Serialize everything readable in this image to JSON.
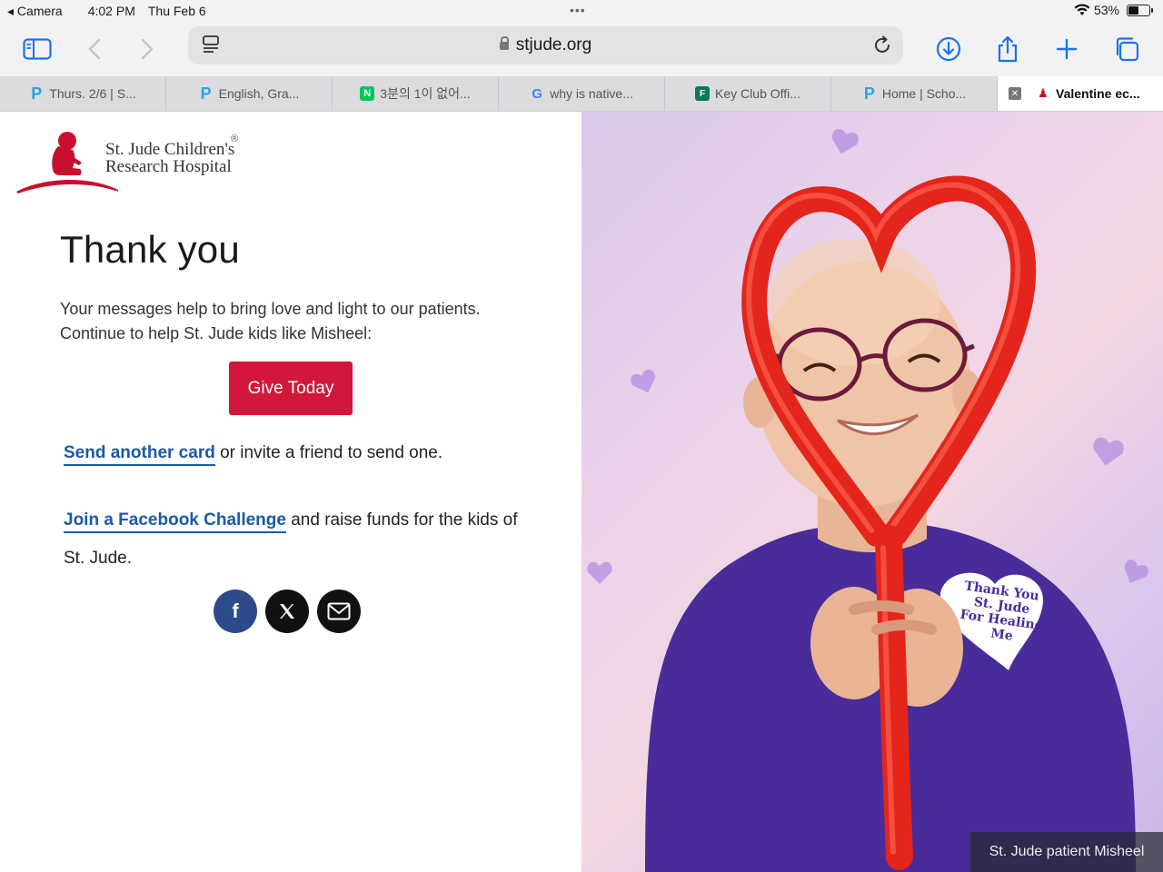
{
  "status": {
    "back_app": "Camera",
    "time": "4:02 PM",
    "date": "Thu Feb 6",
    "battery": "53%",
    "battery_level": 0.53
  },
  "browser": {
    "url": "stjude.org",
    "tabs": [
      {
        "label": "Thurs. 2/6 | S...",
        "favicon": "p-icon"
      },
      {
        "label": "English, Gra...",
        "favicon": "p-icon"
      },
      {
        "label": "3분의 1이 없어...",
        "favicon": "naver-icon"
      },
      {
        "label": "why is native...",
        "favicon": "google-icon"
      },
      {
        "label": "Key Club Offi...",
        "favicon": "forms-icon"
      },
      {
        "label": "Home | Scho...",
        "favicon": "p-icon"
      },
      {
        "label": "Valentine ec...",
        "favicon": "stjude-icon",
        "active": true
      }
    ]
  },
  "page": {
    "logo_line1": "St. Jude Children's",
    "logo_line2": "Research Hospital",
    "logo_reg": "®",
    "heading": "Thank you",
    "intro_line1": "Your messages help to bring love and light to our patients.",
    "intro_line2": "Continue to help St. Jude kids like Misheel:",
    "give_button": "Give Today",
    "send_link": "Send another card",
    "send_rest": " or invite a friend to send one.",
    "challenge_link": "Join a Facebook Challenge",
    "challenge_rest": " and raise funds for the kids of St. Jude.",
    "social_facebook": "f",
    "photo_caption": "St. Jude patient Misheel",
    "shirt_text": [
      "Thank You",
      "St. Jude",
      "For Healing",
      "Me"
    ]
  },
  "colors": {
    "accent": "#d3173c",
    "link": "#1a5aa6",
    "facebook": "#2d4a8a",
    "browser_blue": "#1a73e8"
  }
}
